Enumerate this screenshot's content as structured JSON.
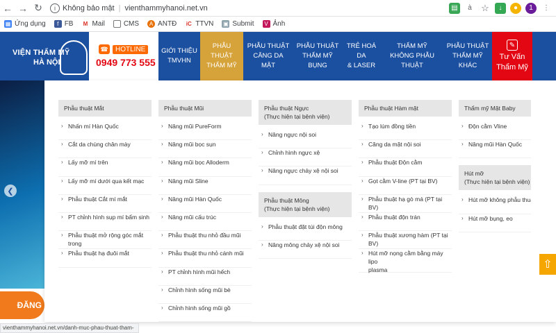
{
  "browser": {
    "security_label": "Không bảo mật",
    "url_host": "vienthammyhanoi.net.vn",
    "bookmarks": [
      "Ứng dụng",
      "FB",
      "Mail",
      "CMS",
      "ANTĐ",
      "TTVN",
      "Submit",
      "Ảnh"
    ],
    "status_url": "vienthammyhanoi.net.vn/danh-muc-phau-thuat-tham-my/"
  },
  "header": {
    "logo_line1": "VIỆN THẨM MỸ",
    "logo_line2": "HÀ NỘI",
    "hotline_label": "HOTLINE",
    "hotline_phone": "0949 773 555",
    "menu": [
      {
        "line1": "GIỚI THIỆU",
        "line2": "TMVHN"
      },
      {
        "line1": "PHẪU THUẬT",
        "line2": "THẨM MỸ"
      },
      {
        "line1": "PHẪU THUẬT",
        "line2": "CĂNG DA MẶT"
      },
      {
        "line1": "PHẪU THUẬT",
        "line2": "THẨM MỸ BỤNG"
      },
      {
        "line1": "TRẺ HOÁ DA",
        "line2": "& LASER"
      },
      {
        "line1": "THẨM MỸ",
        "line2": "KHÔNG PHẪU THUẬT"
      },
      {
        "line1": "PHẪU THUẬT",
        "line2": "THẨM MỸ KHÁC"
      }
    ],
    "cta_line1": "Tư Vấn",
    "cta_line2": "Thẩm Mỹ"
  },
  "banner": {
    "register_label": "ĐĂNG"
  },
  "mega": {
    "col1": {
      "head": "Phẫu thuật Mắt",
      "items": [
        "Nhấn mí Hàn Quốc",
        "Cắt da chùng chân mày",
        "Lấy mỡ mí trên",
        "Lấy mỡ mí dưới qua kết mạc",
        "Phẫu thuật Cắt mí mắt",
        "PT chỉnh hình sụp mí bẩm sinh",
        "Phẫu thuật mở rộng góc mắt trong",
        "Phẫu thuật hạ đuôi mắt"
      ]
    },
    "col2": {
      "head": "Phẫu thuật Mũi",
      "items": [
        "Nâng mũi PureForm",
        "Nâng mũi bọc sụn",
        "Nâng mũi bọc Alloderm",
        "Nâng mũi Sline",
        "Nâng mũi Hàn Quốc",
        "Nâng mũi cấu trúc",
        "Phẫu thuật thu nhỏ đầu mũi",
        "Phẫu thuật thu nhỏ cánh mũi",
        "PT chỉnh hình mũi hếch",
        "Chỉnh hình sống mũi bè",
        "Chỉnh hình sống mũi gồ"
      ]
    },
    "col3": {
      "head_line1": "Phẫu thuật Ngực",
      "head_line2": "(Thực hiện tại bệnh viện)",
      "items": [
        "Nâng ngực nội soi",
        "Chỉnh hình ngực xệ",
        "Nâng ngực chảy xệ nội soi"
      ],
      "sub_head_line1": "Phẫu thuật Mông",
      "sub_head_line2": "(Thực hiện tại bệnh viện)",
      "sub_items": [
        "Phẫu thuật đặt túi độn mông",
        "Nâng mông chảy xệ nội soi"
      ]
    },
    "col4": {
      "head": "Phẫu thuật Hàm mặt",
      "items": [
        "Tạo lúm đồng tiền",
        "Căng da mặt nội soi",
        "Phẫu thuật Độn cằm",
        "Gọt cằm V-line (PT tại BV)",
        "Phẫu thuật hạ gò má (PT tại BV)",
        "Phẫu thuật độn trán",
        "Phẫu thuật xương hàm (PT tại BV)"
      ],
      "last_line1": "Hút mỡ nọng cằm bằng máy lipo",
      "last_line2": "plasma"
    },
    "col5": {
      "head": "Thẩm mỹ Mặt Baby",
      "items": [
        "Độn cằm Vline",
        "Nâng mũi Hàn Quốc"
      ],
      "sub_head_line1": "Hút mỡ",
      "sub_head_line2": "(Thực hiện tại bệnh viện)",
      "sub_items": [
        "Hút mỡ không phẫu thuật",
        "Hút mỡ bụng, eo"
      ]
    }
  },
  "colors": {
    "header_bg": "#1b4fa0",
    "active_menu": "#d6a23a",
    "cta": "#e30613",
    "hotline_red": "#e30613",
    "register_orange": "#f07a1c"
  }
}
